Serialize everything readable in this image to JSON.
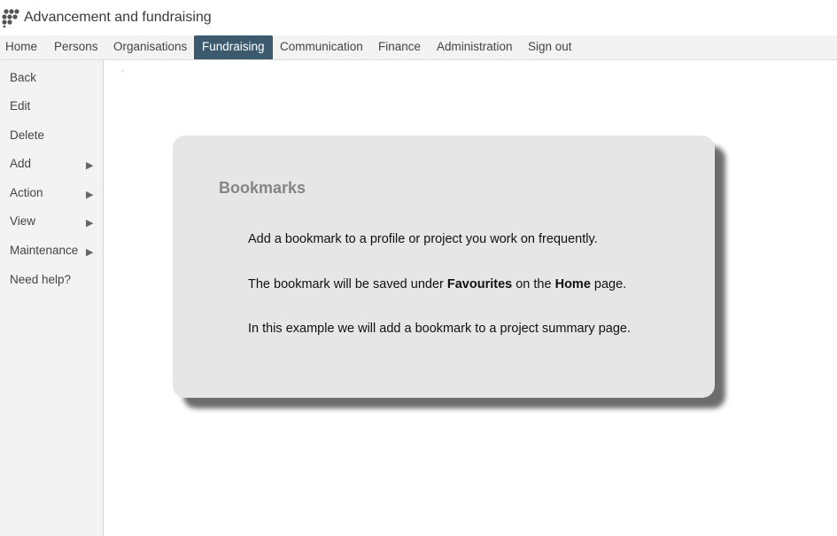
{
  "app": {
    "title": "Advancement and fundraising"
  },
  "menu": {
    "items": [
      {
        "label": "Home"
      },
      {
        "label": "Persons"
      },
      {
        "label": "Organisations"
      },
      {
        "label": "Fundraising",
        "active": true
      },
      {
        "label": "Communication"
      },
      {
        "label": "Finance"
      },
      {
        "label": "Administration"
      },
      {
        "label": "Sign out"
      }
    ]
  },
  "sidebar": {
    "items": [
      {
        "label": "Back"
      },
      {
        "label": "Edit"
      },
      {
        "label": "Delete"
      },
      {
        "label": "Add",
        "submenu": true
      },
      {
        "label": "Action",
        "submenu": true
      },
      {
        "label": "View",
        "submenu": true
      },
      {
        "label": "Maintenance",
        "submenu": true
      },
      {
        "label": "Need help?"
      }
    ],
    "arrow_glyph": "▶"
  },
  "content": {
    "tick": "'"
  },
  "card": {
    "title": "Bookmarks",
    "line1": "Add a bookmark to a profile or project you work on frequently.",
    "line2": {
      "before": "The bookmark will be saved under ",
      "bold1": "Favourites",
      "middle": " on the ",
      "bold2": "Home",
      "after": " page."
    },
    "line3": "In this example we will add a bookmark to a project summary page."
  },
  "colors": {
    "active_tab": "#3b5a6e",
    "card_bg": "#e6e6e6",
    "card_title": "#858585",
    "menubar_bg": "#f3f3f3"
  }
}
